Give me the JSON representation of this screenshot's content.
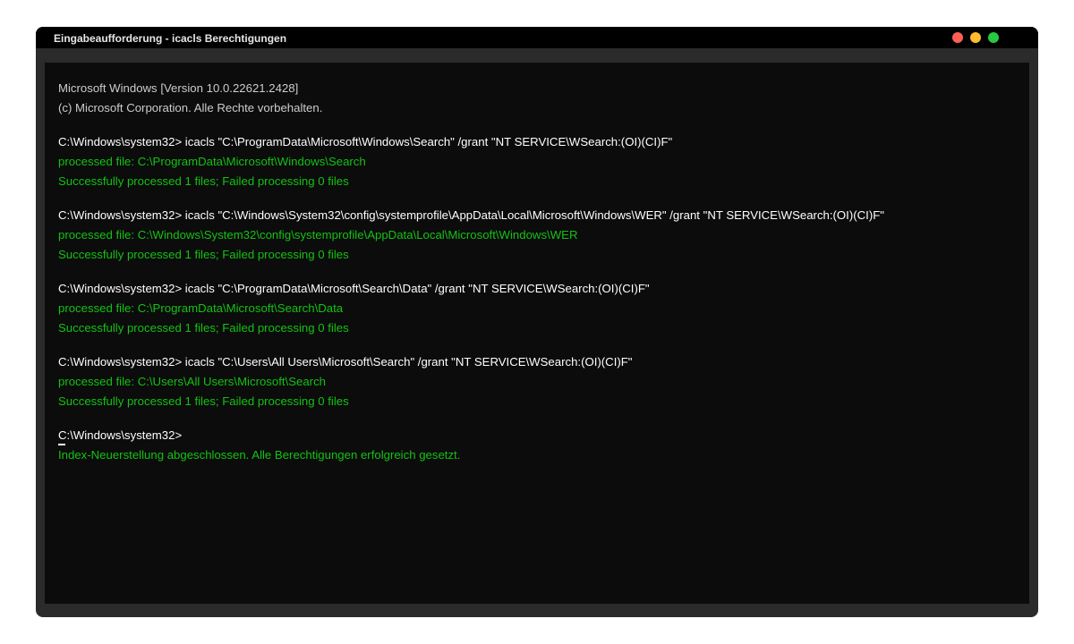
{
  "window": {
    "title": "Eingabeaufforderung - icacls Berechtigungen",
    "controls": {
      "close_color": "#ff5f57",
      "minimize_color": "#febc2e",
      "maximize_color": "#28c840"
    }
  },
  "terminal": {
    "banner": [
      "Microsoft Windows [Version 10.0.22621.2428]",
      "(c) Microsoft Corporation. Alle Rechte vorbehalten."
    ],
    "blocks": [
      {
        "command": "C:\\Windows\\system32> icacls \"C:\\ProgramData\\Microsoft\\Windows\\Search\" /grant \"NT SERVICE\\WSearch:(OI)(CI)F\"",
        "processed": "processed file: C:\\ProgramData\\Microsoft\\Windows\\Search",
        "summary": "Successfully processed 1 files; Failed processing 0 files"
      },
      {
        "command": "C:\\Windows\\system32> icacls \"C:\\Windows\\System32\\config\\systemprofile\\AppData\\Local\\Microsoft\\Windows\\WER\" /grant \"NT SERVICE\\WSearch:(OI)(CI)F\"",
        "processed": "processed file: C:\\Windows\\System32\\config\\systemprofile\\AppData\\Local\\Microsoft\\Windows\\WER",
        "summary": "Successfully processed 1 files; Failed processing 0 files"
      },
      {
        "command": "C:\\Windows\\system32> icacls \"C:\\ProgramData\\Microsoft\\Search\\Data\" /grant \"NT SERVICE\\WSearch:(OI)(CI)F\"",
        "processed": "processed file: C:\\ProgramData\\Microsoft\\Search\\Data",
        "summary": "Successfully processed 1 files; Failed processing 0 files"
      },
      {
        "command": "C:\\Windows\\system32> icacls \"C:\\Users\\All Users\\Microsoft\\Search\" /grant \"NT SERVICE\\WSearch:(OI)(CI)F\"",
        "processed": "processed file: C:\\Users\\All Users\\Microsoft\\Search",
        "summary": "Successfully processed 1 files; Failed processing 0 files"
      }
    ],
    "prompt": "C:\\Windows\\system32>",
    "final_message": "Index-Neuerstellung abgeschlossen. Alle Berechtigungen erfolgreich gesetzt.",
    "colors": {
      "background": "#0c0c0c",
      "command_text": "#ffffff",
      "banner_text": "#cccccc",
      "success_text": "#13c213"
    }
  }
}
